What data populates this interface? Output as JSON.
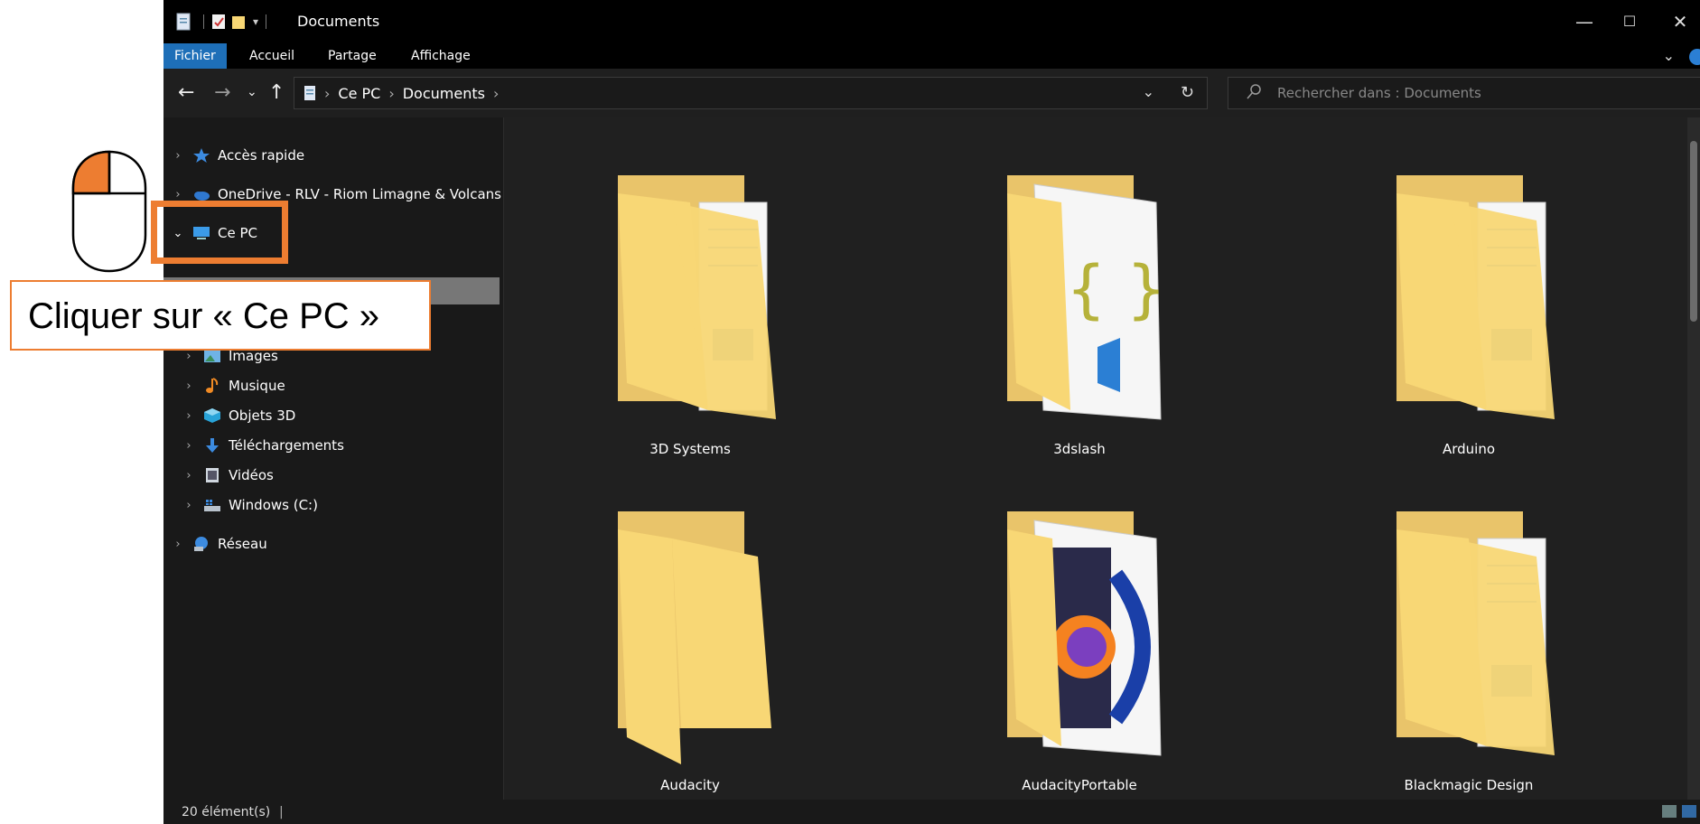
{
  "window": {
    "title": "Documents",
    "colors": {
      "background": "#191919",
      "ribbon_active": "#1e6fb8",
      "accent_orange": "#ed7d31"
    }
  },
  "ribbon": {
    "tabs": [
      "Fichier",
      "Accueil",
      "Partage",
      "Affichage"
    ],
    "active_tab": "Fichier"
  },
  "address": {
    "crumbs": [
      "Ce PC",
      "Documents"
    ],
    "search_placeholder": "Rechercher dans : Documents"
  },
  "nav": {
    "items": [
      {
        "label": "Accès rapide",
        "icon": "star-icon"
      },
      {
        "label": "OneDrive - RLV - Riom Limagne & Volcans",
        "icon": "cloud-icon"
      },
      {
        "label": "Ce PC",
        "icon": "computer-icon",
        "expanded": true
      },
      {
        "label": "Images",
        "icon": "images-icon"
      },
      {
        "label": "Musique",
        "icon": "music-icon"
      },
      {
        "label": "Objets 3D",
        "icon": "cube-icon"
      },
      {
        "label": "Téléchargements",
        "icon": "download-icon"
      },
      {
        "label": "Vidéos",
        "icon": "video-icon"
      },
      {
        "label": "Windows (C:)",
        "icon": "drive-icon"
      },
      {
        "label": "Réseau",
        "icon": "network-icon"
      }
    ]
  },
  "folders": [
    {
      "name": "3D Systems",
      "kind": "docs"
    },
    {
      "name": "3dslash",
      "kind": "code"
    },
    {
      "name": "Arduino",
      "kind": "docs"
    },
    {
      "name": "Audacity",
      "kind": "empty"
    },
    {
      "name": "AudacityPortable",
      "kind": "apps"
    },
    {
      "name": "Blackmagic Design",
      "kind": "docs"
    }
  ],
  "status": {
    "count": "20 élément(s)"
  },
  "tutorial": {
    "callout": "Cliquer sur « Ce PC »"
  }
}
